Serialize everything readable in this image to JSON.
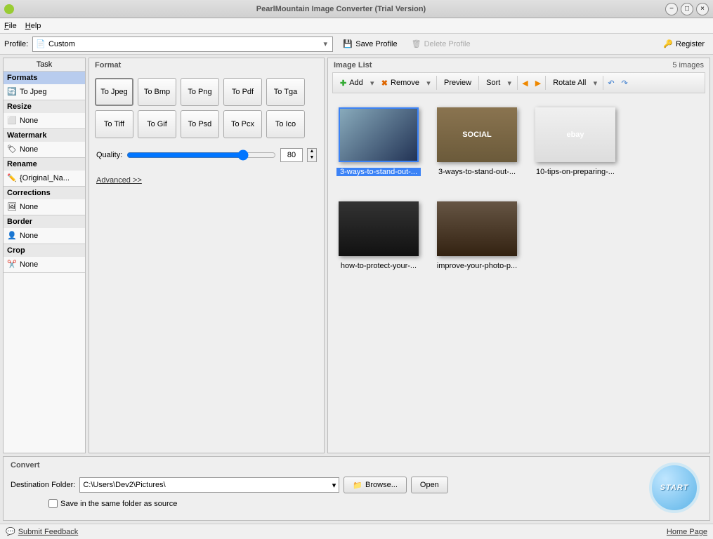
{
  "window": {
    "title": "PearlMountain Image Converter (Trial Version)"
  },
  "menu": {
    "file": "File",
    "help": "Help"
  },
  "toolbar": {
    "profile_label": "Profile:",
    "profile_value": "Custom",
    "save_profile": "Save Profile",
    "delete_profile": "Delete Profile",
    "register": "Register"
  },
  "task": {
    "header": "Task",
    "items": [
      {
        "cat": "Formats",
        "val": "To Jpeg",
        "active": true
      },
      {
        "cat": "Resize",
        "val": "None"
      },
      {
        "cat": "Watermark",
        "val": "None"
      },
      {
        "cat": "Rename",
        "val": "{Original_Na..."
      },
      {
        "cat": "Corrections",
        "val": "None"
      },
      {
        "cat": "Border",
        "val": "None"
      },
      {
        "cat": "Crop",
        "val": "None"
      }
    ]
  },
  "format": {
    "title": "Format",
    "buttons": [
      "To Jpeg",
      "To Bmp",
      "To Png",
      "To Pdf",
      "To Tga",
      "To Tiff",
      "To Gif",
      "To Psd",
      "To Pcx",
      "To Ico"
    ],
    "quality_label": "Quality:",
    "quality_value": "80",
    "advanced": "Advanced >>"
  },
  "imagelist": {
    "title": "Image List",
    "count": "5 images",
    "tb": {
      "add": "Add",
      "remove": "Remove",
      "preview": "Preview",
      "sort": "Sort",
      "rotate_all": "Rotate All"
    },
    "thumbs": [
      {
        "cap": "3-ways-to-stand-out-...",
        "sel": true
      },
      {
        "cap": "3-ways-to-stand-out-..."
      },
      {
        "cap": "10-tips-on-preparing-..."
      },
      {
        "cap": "how-to-protect-your-..."
      },
      {
        "cap": "improve-your-photo-p..."
      }
    ]
  },
  "convert": {
    "title": "Convert",
    "dest_label": "Destination Folder:",
    "dest_value": "C:\\Users\\Dev2\\Pictures\\",
    "browse": "Browse...",
    "open": "Open",
    "save_same": "Save in the same folder as source",
    "start": "START"
  },
  "status": {
    "feedback": "Submit Feedback",
    "home": "Home Page"
  }
}
